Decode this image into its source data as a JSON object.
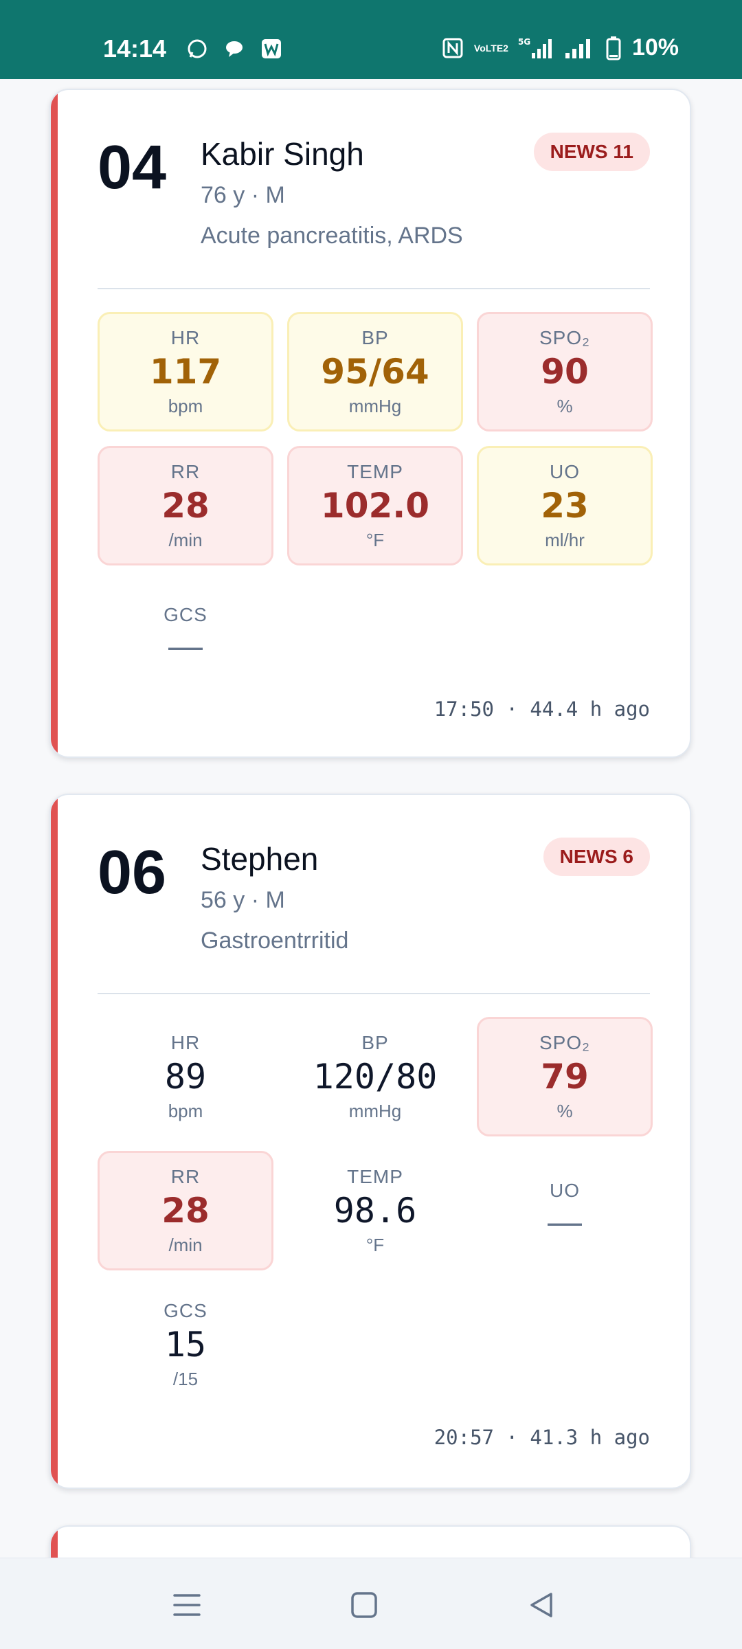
{
  "status_bar": {
    "time": "14:14",
    "left_icons": [
      "whatsapp-icon",
      "chat-bubble-icon",
      "w-app-icon"
    ],
    "right_icons": [
      "nfc-icon",
      "volte-icon",
      "5g-signal-icon",
      "signal-icon"
    ],
    "network_label": "VoLTE2",
    "fiveg_label": "5G",
    "battery": "10%"
  },
  "patients": [
    {
      "bed": "04",
      "name": "Kabir Singh",
      "meta": "76 y · M",
      "diagnosis": "Acute pancreatitis, ARDS",
      "news": "NEWS 11",
      "vitals": {
        "hr": {
          "label": "HR",
          "value": "117",
          "unit": "bpm",
          "status": "warn"
        },
        "bp": {
          "label": "BP",
          "value": "95/64",
          "unit": "mmHg",
          "status": "warn"
        },
        "spo2": {
          "label": "SPO₂",
          "value": "90",
          "unit": "%",
          "status": "crit"
        },
        "rr": {
          "label": "RR",
          "value": "28",
          "unit": "/min",
          "status": "crit"
        },
        "temp": {
          "label": "TEMP",
          "value": "102.0",
          "unit": "°F",
          "status": "crit"
        },
        "uo": {
          "label": "UO",
          "value": "23",
          "unit": "ml/hr",
          "status": "warn"
        },
        "gcs": {
          "label": "GCS",
          "value": "—",
          "unit": "",
          "status": "none"
        }
      },
      "timestamp": "17:50 · 44.4 h ago"
    },
    {
      "bed": "06",
      "name": "Stephen",
      "meta": "56 y · M",
      "diagnosis": "Gastroentrritid",
      "news": "NEWS 6",
      "vitals": {
        "hr": {
          "label": "HR",
          "value": "89",
          "unit": "bpm",
          "status": "none"
        },
        "bp": {
          "label": "BP",
          "value": "120/80",
          "unit": "mmHg",
          "status": "none"
        },
        "spo2": {
          "label": "SPO₂",
          "value": "79",
          "unit": "%",
          "status": "crit"
        },
        "rr": {
          "label": "RR",
          "value": "28",
          "unit": "/min",
          "status": "crit"
        },
        "temp": {
          "label": "TEMP",
          "value": "98.6",
          "unit": "°F",
          "status": "none"
        },
        "uo": {
          "label": "UO",
          "value": "—",
          "unit": "",
          "status": "none"
        },
        "gcs": {
          "label": "GCS",
          "value": "15",
          "unit": "/15",
          "status": "none"
        }
      },
      "timestamp": "20:57 · 41.3 h ago"
    }
  ],
  "nav_bar": {
    "icons": [
      "menu-icon",
      "home-square-icon",
      "back-triangle-icon"
    ]
  },
  "colors": {
    "status_bar": "#0f766e",
    "critical_border": "#e05252",
    "warn_bg": "#fefbe8",
    "crit_bg": "#fdeded",
    "warn_text": "#a16207",
    "crit_text": "#9b2c2c"
  }
}
